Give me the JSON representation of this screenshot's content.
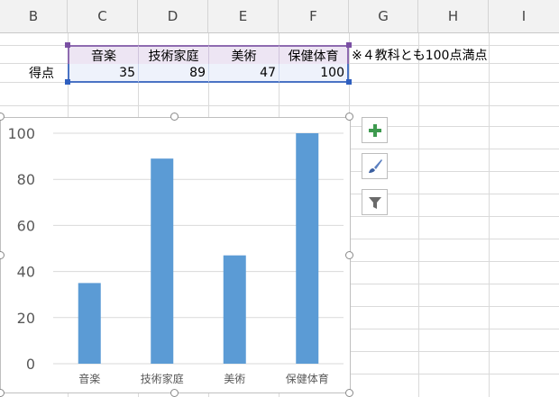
{
  "columns": [
    "B",
    "C",
    "D",
    "E",
    "F",
    "G",
    "H",
    "I"
  ],
  "row_label": "得点",
  "table": {
    "headers": [
      "音楽",
      "技術家庭",
      "美術",
      "保健体育"
    ],
    "values": [
      "35",
      "89",
      "47",
      "100"
    ]
  },
  "note": "※４教科とも100点満点",
  "chart_data": {
    "type": "bar",
    "categories": [
      "音楽",
      "技術家庭",
      "美術",
      "保健体育"
    ],
    "values": [
      35,
      89,
      47,
      100
    ],
    "ylim": [
      0,
      100
    ],
    "yticks": [
      "0",
      "20",
      "40",
      "60",
      "80",
      "100"
    ],
    "bar_color": "#5b9bd5",
    "grid": true,
    "title": "",
    "xlabel": "",
    "ylabel": ""
  },
  "side_buttons": [
    {
      "icon": "plus-icon"
    },
    {
      "icon": "brush-icon"
    },
    {
      "icon": "filter-icon"
    }
  ]
}
